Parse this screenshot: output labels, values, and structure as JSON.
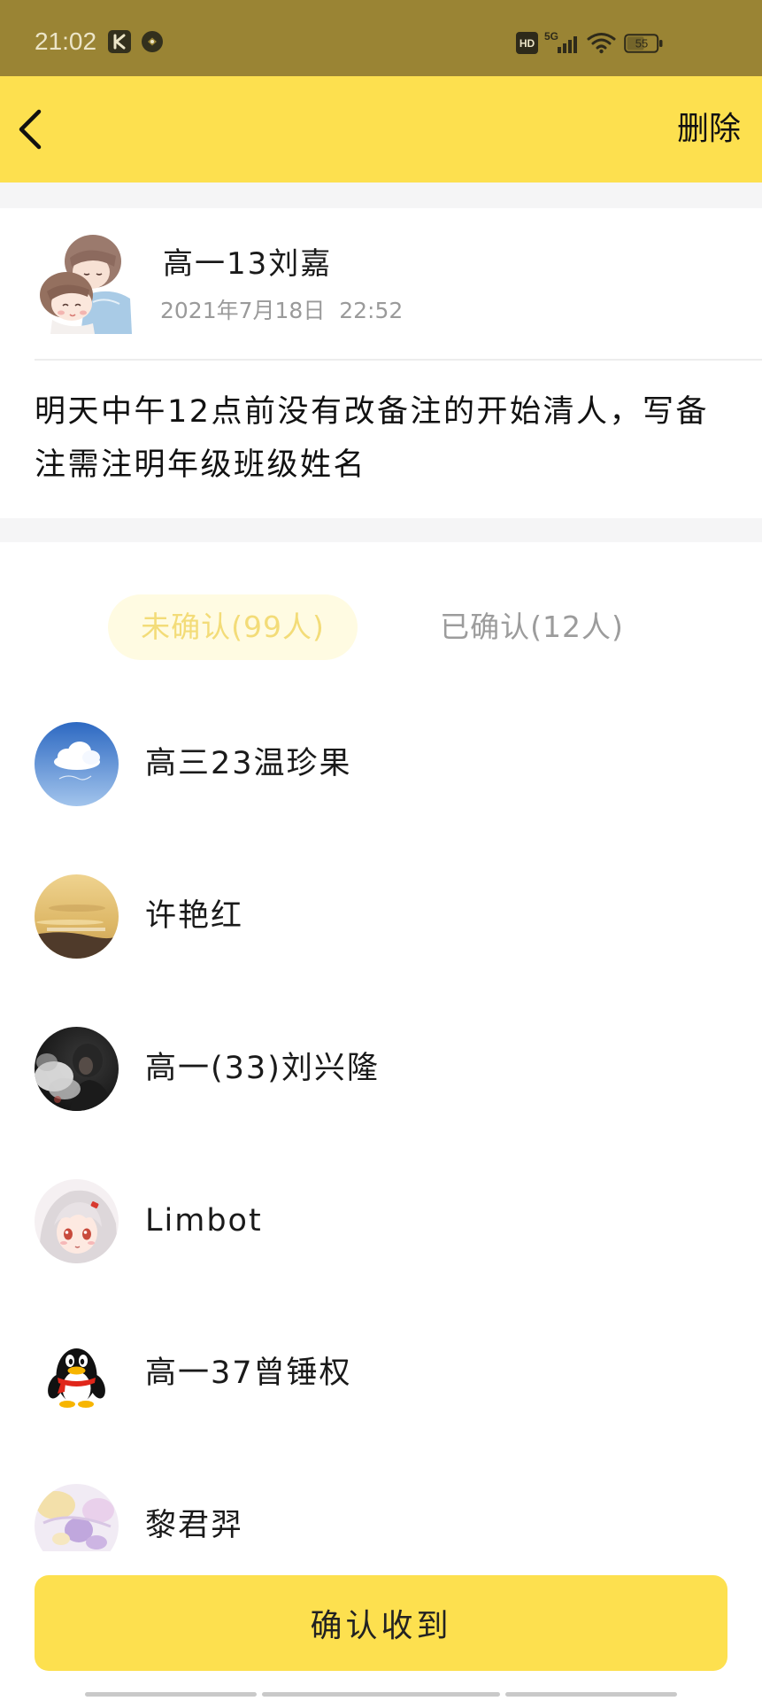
{
  "colors": {
    "status_bar_bg": "#9a8434",
    "accent": "#fde04f",
    "page_gap": "#f5f5f6",
    "tab_active_bg": "#fffbe2",
    "tab_active_text": "#f3dc78",
    "tab_inactive_text": "#9c9c9c",
    "secondary_text": "#9a9a9a"
  },
  "status_bar": {
    "time": "21:02",
    "hd_label": "HD",
    "network_label": "5G",
    "battery_level": "55"
  },
  "app_bar": {
    "back_icon": "chevron-left-icon",
    "delete_label": "删除"
  },
  "post": {
    "author": "高一13刘嘉",
    "avatar": "couple-illustration-avatar",
    "datetime": "2021年7月18日  22:52",
    "content": "明天中午12点前没有改备注的开始清人，写备注需注明年级班级姓名"
  },
  "tabs": [
    {
      "label": "未确认(99人)",
      "active": true
    },
    {
      "label": "已确认(12人)",
      "active": false
    }
  ],
  "members": [
    {
      "name": "高三23温珍果",
      "avatar": "sky-cloud-avatar"
    },
    {
      "name": "许艳红",
      "avatar": "desert-avatar"
    },
    {
      "name": "高一(33)刘兴隆",
      "avatar": "smoke-portrait-avatar"
    },
    {
      "name": "Limbot",
      "avatar": "anime-girl-avatar"
    },
    {
      "name": "高一37曾锤权",
      "avatar": "qq-penguin-avatar"
    },
    {
      "name": "黎君羿",
      "avatar": "pastel-art-avatar"
    }
  ],
  "confirm_button": {
    "label": "确认收到"
  }
}
